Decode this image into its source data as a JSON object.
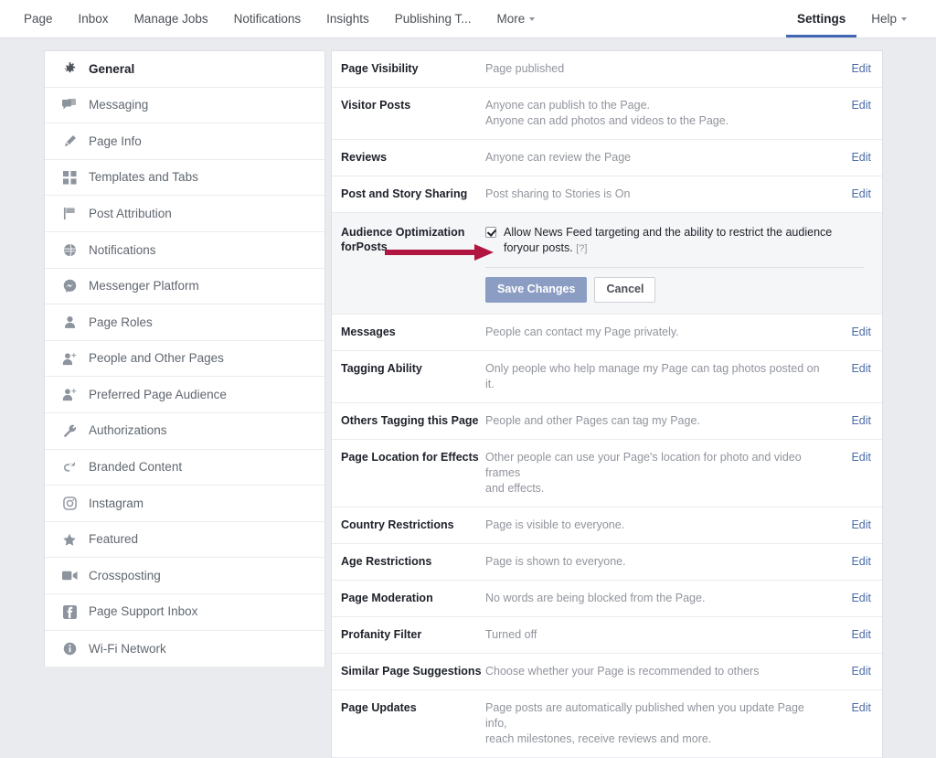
{
  "topnav": {
    "left_items": [
      {
        "label": "Page",
        "icon": "",
        "caret": false
      },
      {
        "label": "Inbox",
        "icon": "",
        "caret": false
      },
      {
        "label": "Manage Jobs",
        "icon": "",
        "caret": false
      },
      {
        "label": "Notifications",
        "icon": "",
        "caret": false
      },
      {
        "label": "Insights",
        "icon": "",
        "caret": false
      },
      {
        "label": "Publishing T...",
        "icon": "",
        "caret": false
      },
      {
        "label": "More",
        "icon": "chevron-down-icon",
        "caret": true
      }
    ],
    "right_items": [
      {
        "label": "Settings",
        "caret": false,
        "active": true
      },
      {
        "label": "Help",
        "caret": true,
        "active": false
      }
    ],
    "active_accent": "#4267b2"
  },
  "sidebar": {
    "items": [
      {
        "label": "General",
        "icon": "gear-icon",
        "active": true
      },
      {
        "label": "Messaging",
        "icon": "messaging-icon",
        "active": false
      },
      {
        "label": "Page Info",
        "icon": "pencil-icon",
        "active": false
      },
      {
        "label": "Templates and Tabs",
        "icon": "grid-icon",
        "active": false
      },
      {
        "label": "Post Attribution",
        "icon": "flag-icon",
        "active": false
      },
      {
        "label": "Notifications",
        "icon": "globe-icon",
        "active": false
      },
      {
        "label": "Messenger Platform",
        "icon": "messenger-icon",
        "active": false
      },
      {
        "label": "Page Roles",
        "icon": "person-icon",
        "active": false
      },
      {
        "label": "People and Other Pages",
        "icon": "person-add-icon",
        "active": false
      },
      {
        "label": "Preferred Page Audience",
        "icon": "person-add-icon",
        "active": false
      },
      {
        "label": "Authorizations",
        "icon": "wrench-icon",
        "active": false
      },
      {
        "label": "Branded Content",
        "icon": "branded-content-icon",
        "active": false
      },
      {
        "label": "Instagram",
        "icon": "instagram-icon",
        "active": false
      },
      {
        "label": "Featured",
        "icon": "star-icon",
        "active": false
      },
      {
        "label": "Crossposting",
        "icon": "video-icon",
        "active": false
      },
      {
        "label": "Page Support Inbox",
        "icon": "facebook-icon",
        "active": false
      },
      {
        "label": "Wi-Fi Network",
        "icon": "info-icon",
        "active": false
      }
    ]
  },
  "settings": {
    "edit_label": "Edit",
    "rows": [
      {
        "title": "Page Visibility",
        "desc": [
          "Page published"
        ]
      },
      {
        "title": "Visitor Posts",
        "desc": [
          "Anyone can publish to the Page.",
          "Anyone can add photos and videos to the Page."
        ]
      },
      {
        "title": "Reviews",
        "desc": [
          "Anyone can review the Page"
        ]
      },
      {
        "title": "Post and Story Sharing",
        "desc": [
          "Post sharing to Stories is On"
        ]
      },
      {
        "title": "Messages",
        "desc": [
          "People can contact my Page privately."
        ]
      },
      {
        "title": "Tagging Ability",
        "desc": [
          "Only people who help manage my Page can tag photos posted on it."
        ]
      },
      {
        "title": "Others Tagging this Page",
        "desc": [
          "People and other Pages can tag my Page."
        ]
      },
      {
        "title": "Page Location for Effects",
        "desc": [
          "Other people can use your Page's location for photo and video frames",
          "and effects."
        ]
      },
      {
        "title": "Country Restrictions",
        "desc": [
          "Page is visible to everyone."
        ]
      },
      {
        "title": "Age Restrictions",
        "desc": [
          "Page is shown to everyone."
        ]
      },
      {
        "title": "Page Moderation",
        "desc": [
          "No words are being blocked from the Page."
        ]
      },
      {
        "title": "Profanity Filter",
        "desc": [
          "Turned off"
        ]
      },
      {
        "title": "Similar Page Suggestions",
        "desc": [
          "Choose whether your Page is recommended to others"
        ]
      },
      {
        "title": "Page Updates",
        "desc": [
          "Page posts are automatically published when you update Page info,",
          "reach milestones, receive reviews and more."
        ]
      }
    ],
    "expanded": {
      "title_line1": "Audience Optimization for",
      "title_line2": "Posts",
      "checkbox_checked": true,
      "checkbox_text_line1": "Allow News Feed targeting and the ability to restrict the audience for",
      "checkbox_text_line2": "your posts.",
      "help_label": "[?]",
      "save_label": "Save Changes",
      "cancel_label": "Cancel",
      "save_color": "#8b9dc3"
    }
  },
  "annotation": {
    "arrow_color": "#b01641",
    "arrow_label": "red-arrow-pointing-at-audience-optimization"
  }
}
